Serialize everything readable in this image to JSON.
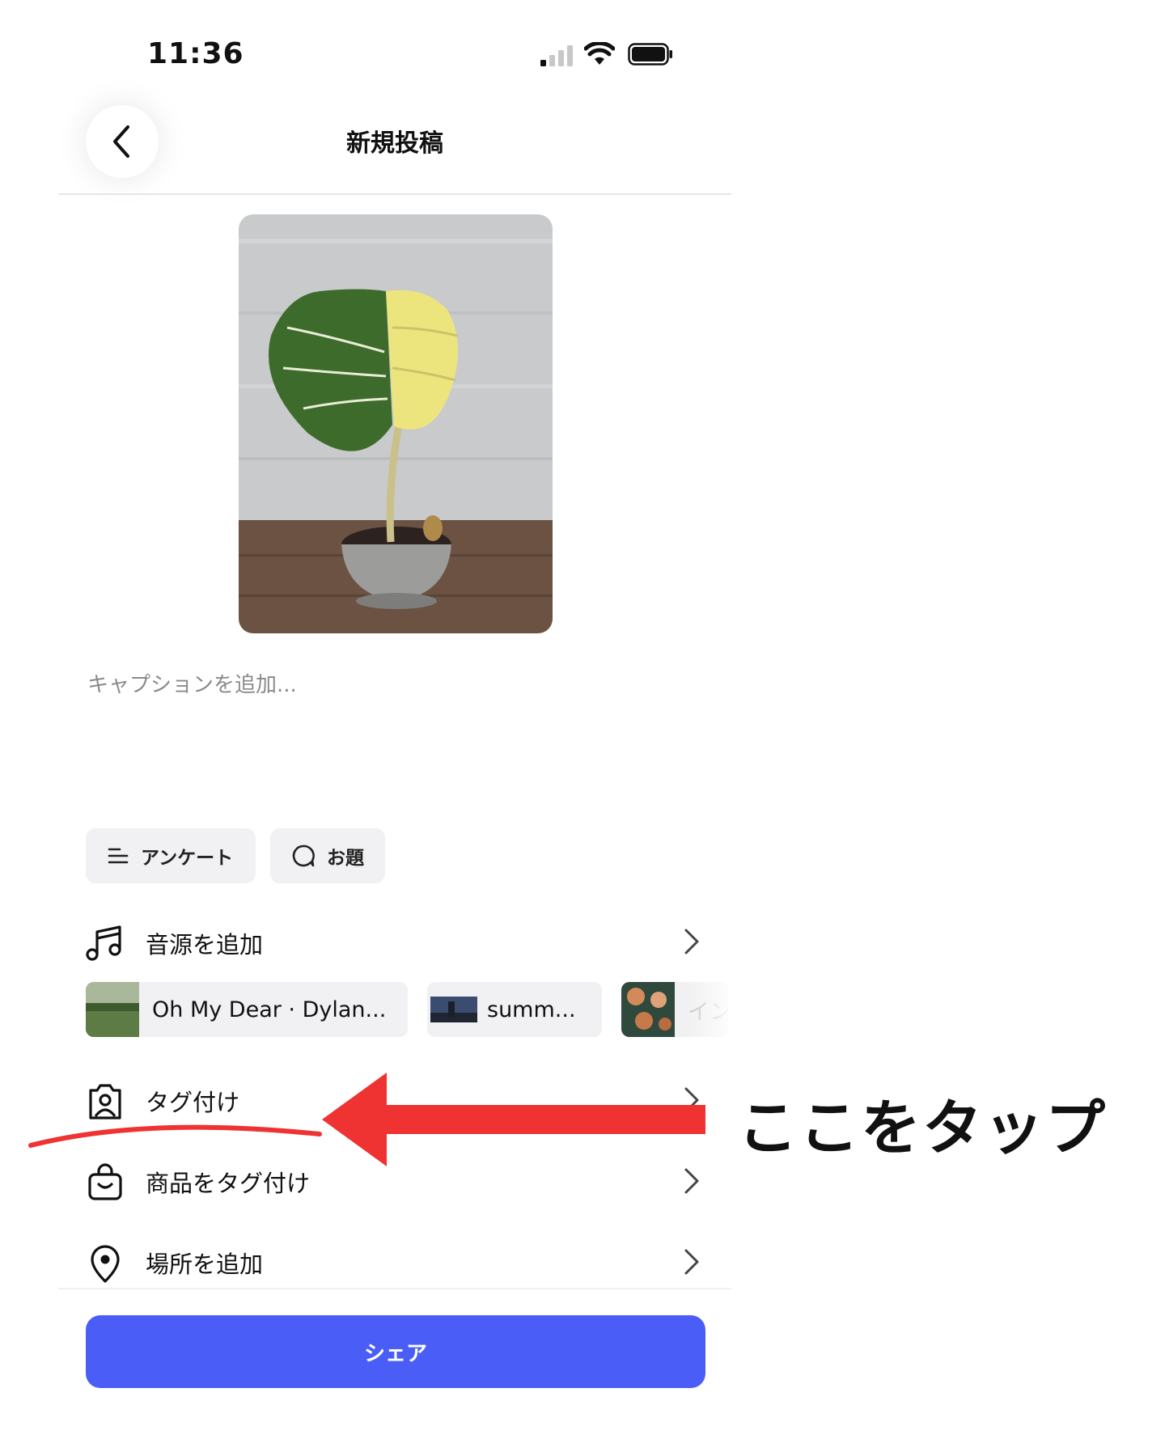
{
  "status_bar": {
    "time": "11:36",
    "icons": [
      "signal-icon",
      "wifi-icon",
      "battery-icon"
    ]
  },
  "header": {
    "title": "新規投稿",
    "back_icon": "chevron-left-icon"
  },
  "caption": {
    "placeholder": "キャプションを追加..."
  },
  "chips": [
    {
      "label": "アンケート",
      "icon": "list-icon"
    },
    {
      "label": "お題",
      "icon": "chat-bubble-icon"
    }
  ],
  "rows": {
    "music": {
      "label": "音源を追加",
      "icon": "music-note-icon"
    },
    "tag": {
      "label": "タグ付け",
      "icon": "person-tag-icon"
    },
    "product": {
      "label": "商品をタグ付け",
      "icon": "shopping-bag-icon"
    },
    "location": {
      "label": "場所を追加",
      "icon": "location-pin-icon"
    }
  },
  "music_suggestions": [
    {
      "label": "Oh My Dear · Dylan..."
    },
    {
      "label": "summ..."
    },
    {
      "label": "イン"
    }
  ],
  "share": {
    "label": "シェア"
  },
  "annotation": {
    "text": "ここをタップ",
    "color": "#ef3232"
  },
  "colors": {
    "accent": "#4a5df6",
    "annotation": "#ef3232"
  }
}
